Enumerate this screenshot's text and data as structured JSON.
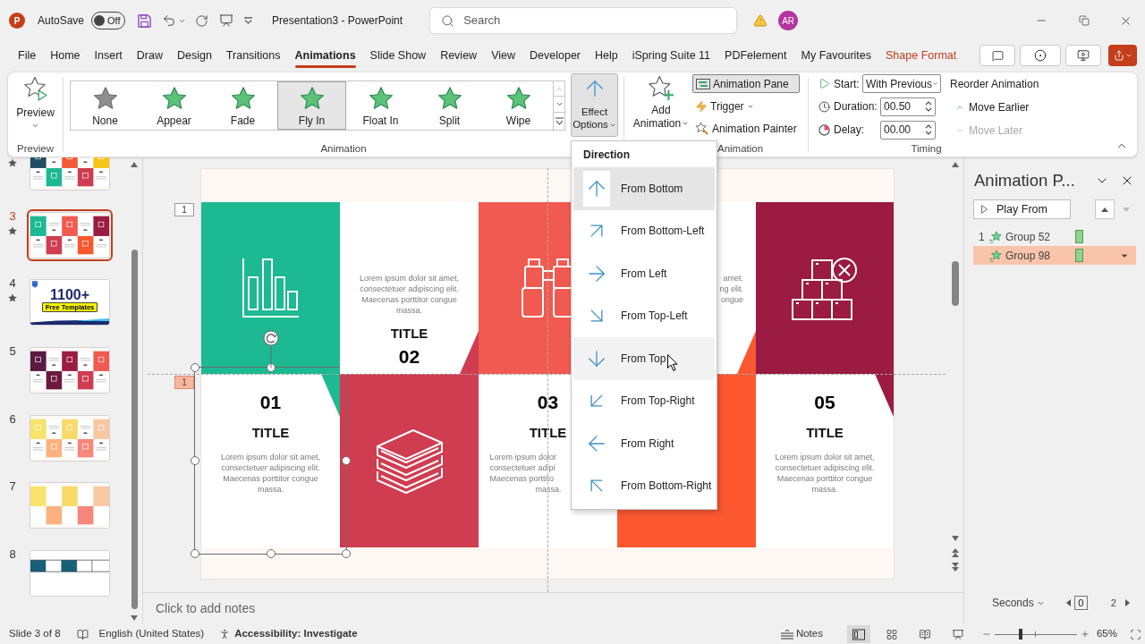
{
  "title_bar": {
    "logo": "P",
    "autosave_label": "AutoSave",
    "autosave": {
      "label": "Off",
      "on": false
    },
    "document_title": "Presentation3 - PowerPoint",
    "search": {
      "placeholder": "Search"
    },
    "avatar": "AR"
  },
  "menu_tabs": [
    {
      "label": "File",
      "kind": "standard",
      "selected": false
    },
    {
      "label": "Home",
      "kind": "standard",
      "selected": false
    },
    {
      "label": "Insert",
      "kind": "standard",
      "selected": false
    },
    {
      "label": "Draw",
      "kind": "standard",
      "selected": false
    },
    {
      "label": "Design",
      "kind": "standard",
      "selected": false
    },
    {
      "label": "Transitions",
      "kind": "standard",
      "selected": false
    },
    {
      "label": "Animations",
      "kind": "standard",
      "selected": true
    },
    {
      "label": "Slide Show",
      "kind": "standard",
      "selected": false
    },
    {
      "label": "Review",
      "kind": "standard",
      "selected": false
    },
    {
      "label": "View",
      "kind": "standard",
      "selected": false
    },
    {
      "label": "Developer",
      "kind": "standard",
      "selected": false
    },
    {
      "label": "Help",
      "kind": "standard",
      "selected": false
    },
    {
      "label": "iSpring Suite 11",
      "kind": "standard",
      "selected": false
    },
    {
      "label": "PDFelement",
      "kind": "standard",
      "selected": false
    },
    {
      "label": "My Favourites",
      "kind": "standard",
      "selected": false
    },
    {
      "label": "Shape Format",
      "kind": "contextual",
      "selected": false
    }
  ],
  "ribbon": {
    "preview": {
      "label": "Preview",
      "group_label": "Preview"
    },
    "gallery": [
      {
        "label": "None",
        "kind": "none",
        "selected": false
      },
      {
        "label": "Appear",
        "kind": "entrance",
        "selected": false
      },
      {
        "label": "Fade",
        "kind": "entrance",
        "selected": false
      },
      {
        "label": "Fly In",
        "kind": "entrance",
        "selected": true
      },
      {
        "label": "Float In",
        "kind": "entrance",
        "selected": false
      },
      {
        "label": "Split",
        "kind": "entrance",
        "selected": false
      },
      {
        "label": "Wipe",
        "kind": "entrance",
        "selected": false
      }
    ],
    "effect_options": {
      "label_top": "Effect",
      "label_bottom": "Options",
      "expanded": true
    },
    "animation_group_label": "Animation",
    "add_animation": {
      "label_top": "Add",
      "label_bottom": "Animation"
    },
    "animation_pane_button": {
      "label": "Animation Pane",
      "on": true
    },
    "trigger": {
      "label": "Trigger"
    },
    "animation_painter": {
      "label": "Animation Painter"
    },
    "advanced_group_label": "Animation",
    "start": {
      "label": "Start:",
      "value": "With Previous"
    },
    "duration": {
      "label": "Duration:",
      "value": "00.50"
    },
    "delay": {
      "label": "Delay:",
      "value": "00.00"
    },
    "reorder_label": "Reorder Animation",
    "move_earlier": {
      "label": "Move Earlier",
      "disabled": false
    },
    "move_later": {
      "label": "Move Later",
      "disabled": true
    },
    "timing_group_label": "Timing"
  },
  "slides_panel": {
    "slides": [
      {
        "kind": "steps",
        "starred": true,
        "selected": false
      },
      {
        "number": "3",
        "kind": "steps",
        "starred": true,
        "selected": true
      },
      {
        "number": "4",
        "kind": "promo",
        "headline": "1100+",
        "badge": "Free Templates",
        "starred": true,
        "selected": false
      },
      {
        "number": "5",
        "kind": "steps",
        "starred": false,
        "selected": false
      },
      {
        "number": "6",
        "kind": "steps",
        "starred": false,
        "selected": false
      },
      {
        "number": "7",
        "kind": "blocks",
        "starred": false,
        "selected": false
      },
      {
        "number": "8",
        "kind": "table",
        "starred": false,
        "selected": false
      }
    ]
  },
  "slide": {
    "animation_tags": [
      {
        "label": "1",
        "selected": false
      },
      {
        "label": "1",
        "selected": true
      }
    ],
    "columns": [
      {
        "kind": "color_top",
        "color": "#1db992",
        "number": "01",
        "title": "TITLE",
        "body": "Lorem ipsum dolor sit amet, consectetuer adipiscing elit. Maecenas porttitor congue massa.",
        "wedge": true,
        "selected": true
      },
      {
        "kind": "color_bottom",
        "color": "#d03c50",
        "number": "02",
        "title": "TITLE",
        "body": "Lorem ipsum dolor sit amet, consectetuer adipiscing elit. Maecenas porttitor congue massa.",
        "wedge": true,
        "selected": false
      },
      {
        "kind": "color_top",
        "color": "#f05a50",
        "number": "03",
        "title": "TITLE",
        "body_lines": [
          "Lorem ipsum dolor",
          "consectetuer adipi",
          "Maecenas porttito",
          "massa."
        ],
        "wedge": false,
        "selected": false
      },
      {
        "kind": "color_bottom",
        "color": "#fc5830",
        "body_fragments": [
          "amet.",
          "ng elit.",
          "ongue"
        ],
        "wedge": true,
        "selected": false
      },
      {
        "kind": "color_top",
        "color": "#9b1b42",
        "number": "05",
        "title": "TITLE",
        "body": "Lorem ipsum dolor sit amet, consectetuer adipiscing elit. Maecenas porttitor congue massa.",
        "wedge": true,
        "selected": false
      }
    ]
  },
  "direction_menu": {
    "heading": "Direction",
    "options": [
      {
        "label": "From Bottom",
        "selected": true,
        "hovered": false
      },
      {
        "label": "From Bottom-Left",
        "selected": false,
        "hovered": false
      },
      {
        "label": "From Left",
        "selected": false,
        "hovered": false
      },
      {
        "label": "From Top-Left",
        "selected": false,
        "hovered": false
      },
      {
        "label": "From Top",
        "selected": false,
        "hovered": true
      },
      {
        "label": "From Top-Right",
        "selected": false,
        "hovered": false
      },
      {
        "label": "From Right",
        "selected": false,
        "hovered": false
      },
      {
        "label": "From Bottom-Right",
        "selected": false,
        "hovered": false
      }
    ]
  },
  "animation_pane": {
    "title": "Animation P...",
    "play_from": "Play From",
    "items": [
      {
        "index": "1",
        "label": "Group 52",
        "selected": false
      },
      {
        "label": "Group 98",
        "selected": true
      }
    ],
    "timeline": {
      "unit": "Seconds",
      "start": "0",
      "end": "2"
    }
  },
  "notes": {
    "placeholder": "Click to add notes"
  },
  "status_bar": {
    "slide_info": "Slide 3 of 8",
    "language": "English (United States)",
    "accessibility": "Accessibility: Investigate",
    "notes": "Notes",
    "views": [
      {
        "selected": true
      },
      {
        "selected": false
      },
      {
        "selected": false
      },
      {
        "selected": false
      }
    ],
    "zoom": {
      "level": 0.32,
      "reading": "65%"
    }
  }
}
